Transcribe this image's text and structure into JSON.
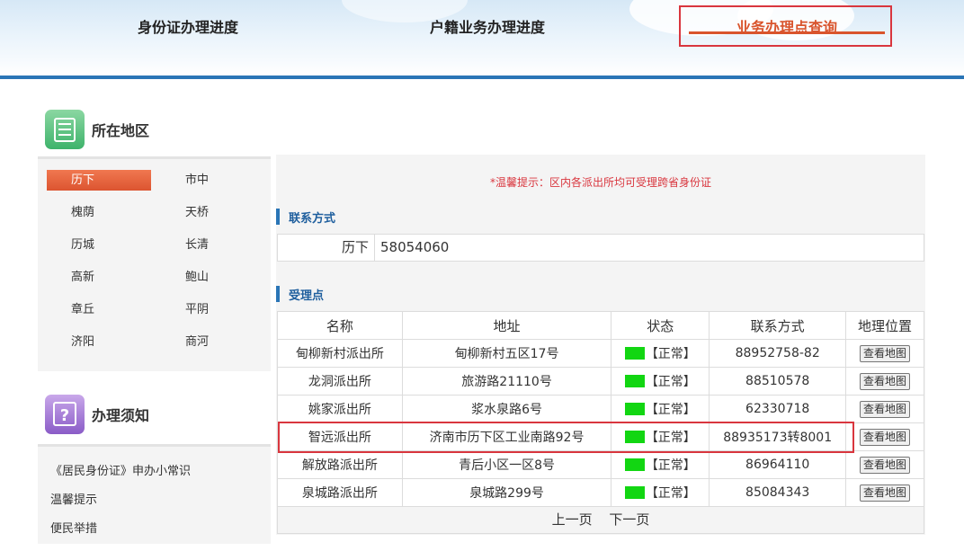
{
  "nav": {
    "tabs": [
      {
        "label": "身份证办理进度"
      },
      {
        "label": "户籍业务办理进度"
      },
      {
        "label": "业务办理点查询"
      }
    ]
  },
  "sidebar": {
    "region_title": "所在地区",
    "regions": [
      "历下",
      "市中",
      "槐荫",
      "天桥",
      "历城",
      "长清",
      "高新",
      "鲍山",
      "章丘",
      "平阴",
      "济阳",
      "商河"
    ],
    "selected_region": "历下",
    "notice_title": "办理须知",
    "notice_links": [
      "《居民身份证》申办小常识",
      "温馨提示",
      "便民举措"
    ]
  },
  "main": {
    "tip": "*温馨提示：区内各派出所均可受理跨省身份证",
    "contact_section_title": "联系方式",
    "contact": {
      "label": "历下",
      "value": "58054060"
    },
    "sites_section_title": "受理点",
    "table_headers": [
      "名称",
      "地址",
      "状态",
      "联系方式",
      "地理位置"
    ],
    "rows": [
      {
        "name": "甸柳新村派出所",
        "address": "甸柳新村五区17号",
        "status": "【正常】",
        "phone": "88952758-82",
        "map": "查看地图"
      },
      {
        "name": "龙洞派出所",
        "address": "旅游路21110号",
        "status": "【正常】",
        "phone": "88510578",
        "map": "查看地图"
      },
      {
        "name": "姚家派出所",
        "address": "浆水泉路6号",
        "status": "【正常】",
        "phone": "62330718",
        "map": "查看地图"
      },
      {
        "name": "智远派出所",
        "address": "济南市历下区工业南路92号",
        "status": "【正常】",
        "phone": "88935173转8001",
        "map": "查看地图"
      },
      {
        "name": "解放路派出所",
        "address": "青后小区一区8号",
        "status": "【正常】",
        "phone": "86964110",
        "map": "查看地图"
      },
      {
        "name": "泉城路派出所",
        "address": "泉城路299号",
        "status": "【正常】",
        "phone": "85084343",
        "map": "查看地图"
      }
    ],
    "pager": {
      "prev": "上一页",
      "next": "下一页"
    }
  },
  "colors": {
    "accent": "#2a75b6",
    "active_tab": "#d9542c",
    "highlight_border": "#d9363e",
    "status_green": "#12d612"
  },
  "icons": {
    "region_icon": "list-icon",
    "notice_icon": "question-icon"
  }
}
